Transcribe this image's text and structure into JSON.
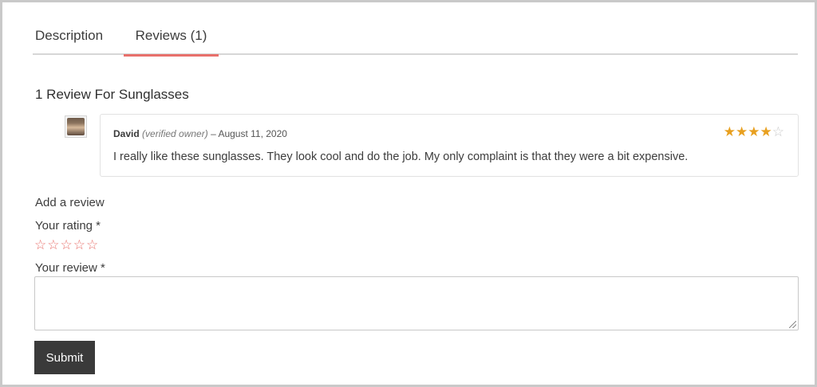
{
  "tabs": [
    {
      "label": "Description",
      "active": false
    },
    {
      "label": "Reviews (1)",
      "active": true
    }
  ],
  "reviews": {
    "title": "1 Review For Sunglasses",
    "items": [
      {
        "author": "David",
        "verified_label": "(verified owner)",
        "separator": "–",
        "date": "August 11, 2020",
        "rating": 4,
        "max_rating": 5,
        "text": "I really like these sunglasses. They look cool and do the job. My only complaint is that they were a bit expensive."
      }
    ]
  },
  "form": {
    "add_review_label": "Add a review",
    "rating_label": "Your rating *",
    "rating_star_count": 5,
    "review_label": "Your review *",
    "review_value": "",
    "submit_label": "Submit"
  },
  "colors": {
    "accent": "#e8706b",
    "star_filled": "#e8a020",
    "button_bg": "#3a3a3a"
  },
  "icons": {
    "star_filled": "★",
    "star_empty": "☆"
  }
}
